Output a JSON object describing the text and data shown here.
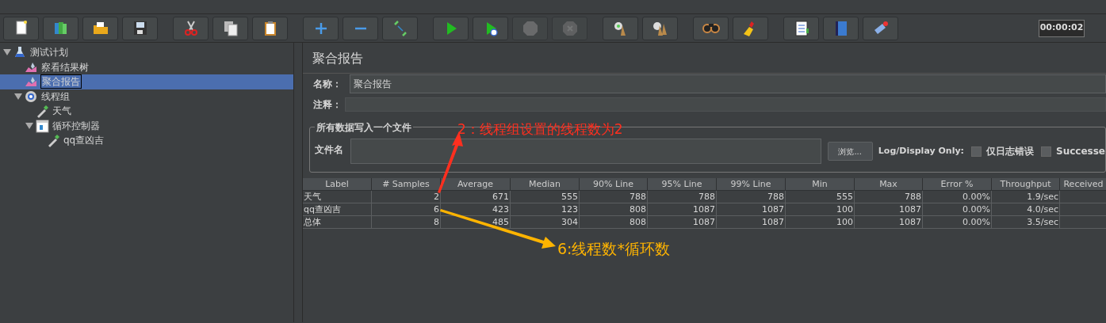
{
  "toolbar": {
    "buttons": [
      {
        "kind": "new",
        "disabled": false
      },
      {
        "kind": "templates",
        "disabled": false
      },
      {
        "kind": "open",
        "disabled": false
      },
      {
        "kind": "save",
        "disabled": false
      },
      {
        "kind": "cut",
        "disabled": false
      },
      {
        "kind": "copy",
        "disabled": false
      },
      {
        "kind": "paste",
        "disabled": false
      },
      {
        "kind": "expand",
        "disabled": false
      },
      {
        "kind": "collapse",
        "disabled": false
      },
      {
        "kind": "toggle",
        "disabled": false
      },
      {
        "kind": "start",
        "disabled": false
      },
      {
        "kind": "start-no-pause",
        "disabled": false
      },
      {
        "kind": "stop",
        "disabled": true
      },
      {
        "kind": "shutdown",
        "disabled": true
      },
      {
        "kind": "clear",
        "disabled": false
      },
      {
        "kind": "clear-all",
        "disabled": false
      },
      {
        "kind": "search",
        "disabled": false
      },
      {
        "kind": "reset-search",
        "disabled": false
      },
      {
        "kind": "functions",
        "disabled": false
      },
      {
        "kind": "help",
        "disabled": false
      },
      {
        "kind": "remote",
        "disabled": false
      }
    ],
    "timer": "00:00:02"
  },
  "tree": [
    {
      "label": "测试计划",
      "kind": "plan",
      "expanded": true,
      "selected": false,
      "children": [
        {
          "label": "察看结果树",
          "kind": "listener",
          "selected": false
        },
        {
          "label": "聚合报告",
          "kind": "listener",
          "selected": true
        },
        {
          "label": "线程组",
          "kind": "threads",
          "expanded": true,
          "selected": false,
          "children": [
            {
              "label": "天气",
              "kind": "sampler",
              "selected": false
            },
            {
              "label": "循环控制器",
              "kind": "controller",
              "expanded": true,
              "selected": false,
              "children": [
                {
                  "label": "qq查凶吉",
                  "kind": "sampler",
                  "selected": false
                }
              ]
            }
          ]
        }
      ]
    }
  ],
  "panel": {
    "title": "聚合报告",
    "name": {
      "label": "名称：",
      "value": "聚合报告"
    },
    "comment": {
      "label": "注释："
    },
    "file_group": {
      "title": "所有数据写入一个文件",
      "file_label": "文件名",
      "browse": "浏览...",
      "log_label": "Log/Display Only:",
      "checkboxes": [
        {
          "label": "仅日志错误",
          "checked": false
        },
        {
          "label": "Successe",
          "checked": false
        }
      ]
    }
  },
  "table": {
    "columns": [
      "Label",
      "# Samples",
      "Average",
      "Median",
      "90% Line",
      "95% Line",
      "99% Line",
      "Min",
      "Max",
      "Error %",
      "Throughput",
      "Received"
    ],
    "rows": [
      [
        "天气",
        "2",
        "671",
        "555",
        "788",
        "788",
        "788",
        "555",
        "788",
        "0.00%",
        "1.9/sec"
      ],
      [
        "qq查凶吉",
        "6",
        "423",
        "123",
        "808",
        "1087",
        "1087",
        "100",
        "1087",
        "0.00%",
        "4.0/sec"
      ],
      [
        "总体",
        "8",
        "485",
        "304",
        "808",
        "1087",
        "1087",
        "100",
        "1087",
        "0.00%",
        "3.5/sec"
      ]
    ]
  },
  "annotations": [
    {
      "text": "2：线程组设置的线程数为2",
      "color": "#ff2f1f"
    },
    {
      "text": "6:线程数*循环数",
      "color": "#ffb400"
    }
  ]
}
